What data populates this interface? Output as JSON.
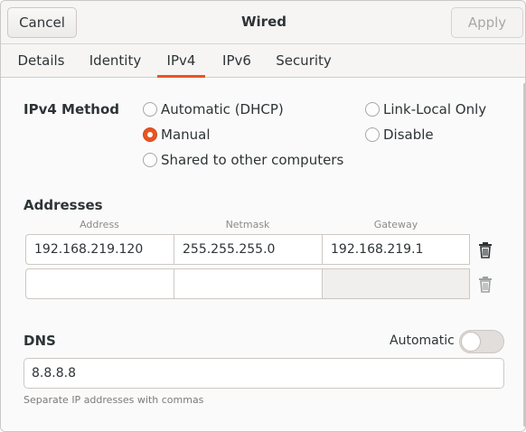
{
  "header": {
    "cancel_label": "Cancel",
    "title": "Wired",
    "apply_label": "Apply"
  },
  "tabs": [
    {
      "label": "Details"
    },
    {
      "label": "Identity"
    },
    {
      "label": "IPv4",
      "active": true
    },
    {
      "label": "IPv6"
    },
    {
      "label": "Security"
    }
  ],
  "ipv4": {
    "method_label": "IPv4 Method",
    "methods": [
      {
        "label": "Automatic (DHCP)",
        "checked": false
      },
      {
        "label": "Manual",
        "checked": true
      },
      {
        "label": "Shared to other computers",
        "checked": false
      },
      {
        "label": "Link-Local Only",
        "checked": false
      },
      {
        "label": "Disable",
        "checked": false
      }
    ]
  },
  "addresses": {
    "section_label": "Addresses",
    "columns": [
      "Address",
      "Netmask",
      "Gateway"
    ],
    "rows": [
      {
        "address": "192.168.219.120",
        "netmask": "255.255.255.0",
        "gateway": "192.168.219.1"
      },
      {
        "address": "",
        "netmask": "",
        "gateway": ""
      }
    ]
  },
  "dns": {
    "section_label": "DNS",
    "automatic_label": "Automatic",
    "automatic_on": false,
    "value": "8.8.8.8",
    "hint": "Separate IP addresses with commas"
  },
  "colors": {
    "accent": "#e95420"
  }
}
